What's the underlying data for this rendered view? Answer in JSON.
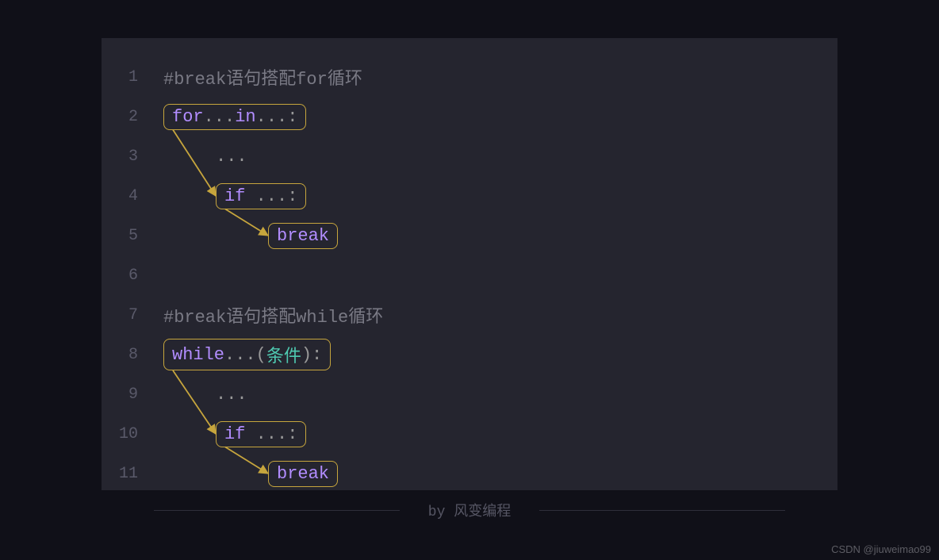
{
  "lines": [
    {
      "num": "1",
      "indent": 0,
      "type": "comment",
      "text": "#break语句搭配for循环"
    },
    {
      "num": "2",
      "indent": 0,
      "type": "box",
      "segments": [
        {
          "cls": "kw",
          "t": "for"
        },
        {
          "cls": "punc",
          "t": "..."
        },
        {
          "cls": "kw",
          "t": "in"
        },
        {
          "cls": "punc",
          "t": "...:"
        }
      ]
    },
    {
      "num": "3",
      "indent": 1,
      "type": "plain",
      "text": "..."
    },
    {
      "num": "4",
      "indent": 1,
      "type": "box",
      "segments": [
        {
          "cls": "kw",
          "t": "if"
        },
        {
          "cls": "punc",
          "t": " ...:"
        }
      ]
    },
    {
      "num": "5",
      "indent": 2,
      "type": "box",
      "segments": [
        {
          "cls": "kw",
          "t": "break"
        }
      ]
    },
    {
      "num": "6",
      "indent": 0,
      "type": "plain",
      "text": ""
    },
    {
      "num": "7",
      "indent": 0,
      "type": "comment",
      "text": "#break语句搭配while循环"
    },
    {
      "num": "8",
      "indent": 0,
      "type": "box",
      "segments": [
        {
          "cls": "kw",
          "t": "while"
        },
        {
          "cls": "punc",
          "t": "...("
        },
        {
          "cls": "cond",
          "t": "条件"
        },
        {
          "cls": "punc",
          "t": "):"
        }
      ]
    },
    {
      "num": "9",
      "indent": 1,
      "type": "plain",
      "text": "..."
    },
    {
      "num": "10",
      "indent": 1,
      "type": "box",
      "segments": [
        {
          "cls": "kw",
          "t": "if"
        },
        {
          "cls": "punc",
          "t": " ...:"
        }
      ]
    },
    {
      "num": "11",
      "indent": 2,
      "type": "box",
      "segments": [
        {
          "cls": "kw",
          "t": "break"
        }
      ]
    }
  ],
  "arrows": [
    {
      "from_line": 2,
      "to_line": 4
    },
    {
      "from_line": 4,
      "to_line": 5
    },
    {
      "from_line": 8,
      "to_line": 10
    },
    {
      "from_line": 10,
      "to_line": 11
    }
  ],
  "footer": "by 风变编程",
  "watermark": "CSDN @jiuweimao99",
  "colors": {
    "bg": "#101018",
    "panel": "#25252f",
    "border": "#c6a53d",
    "keyword": "#b28dff",
    "cond": "#4ec9b0",
    "muted": "#7a7a85"
  }
}
